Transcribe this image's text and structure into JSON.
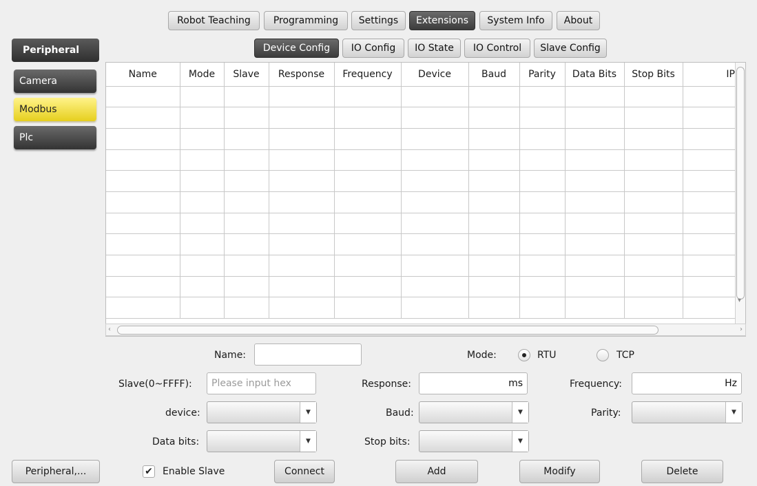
{
  "top_tabs": [
    {
      "label": "Robot Teaching"
    },
    {
      "label": "Programming"
    },
    {
      "label": "Settings"
    },
    {
      "label": "Extensions",
      "active": true
    },
    {
      "label": "System Info"
    },
    {
      "label": "About"
    }
  ],
  "sub_tabs": [
    {
      "label": "Device Config",
      "active": true
    },
    {
      "label": "IO Config"
    },
    {
      "label": "IO State"
    },
    {
      "label": "IO Control"
    },
    {
      "label": "Slave Config"
    }
  ],
  "sidebar": {
    "header": "Peripheral",
    "items": [
      {
        "label": "Camera"
      },
      {
        "label": "Modbus",
        "selected": true
      },
      {
        "label": "Plc"
      }
    ],
    "footer": "Peripheral,..."
  },
  "table": {
    "columns": [
      "Name",
      "Mode",
      "Slave",
      "Response",
      "Frequency",
      "Device",
      "Baud",
      "Parity",
      "Data Bits",
      "Stop Bits",
      "IP"
    ],
    "row_count": 11
  },
  "form": {
    "name_label": "Name:",
    "name_value": "",
    "mode_label": "Mode:",
    "mode_options": [
      "RTU",
      "TCP"
    ],
    "mode_selected": "RTU",
    "slave_label": "Slave(0~FFFF):",
    "slave_placeholder": "Please input hex",
    "response_label": "Response:",
    "response_unit": "ms",
    "frequency_label": "Frequency:",
    "frequency_unit": "Hz",
    "device_label": "device:",
    "baud_label": "Baud:",
    "parity_label": "Parity:",
    "data_bits_label": "Data bits:",
    "stop_bits_label": "Stop bits:",
    "enable_slave_label": "Enable Slave",
    "enable_slave_checked": true
  },
  "actions": {
    "connect": "Connect",
    "add": "Add",
    "modify": "Modify",
    "delete": "Delete"
  },
  "colors": {
    "active_tab": "#3c3c3c",
    "selected_item": "#e6cf1e"
  }
}
